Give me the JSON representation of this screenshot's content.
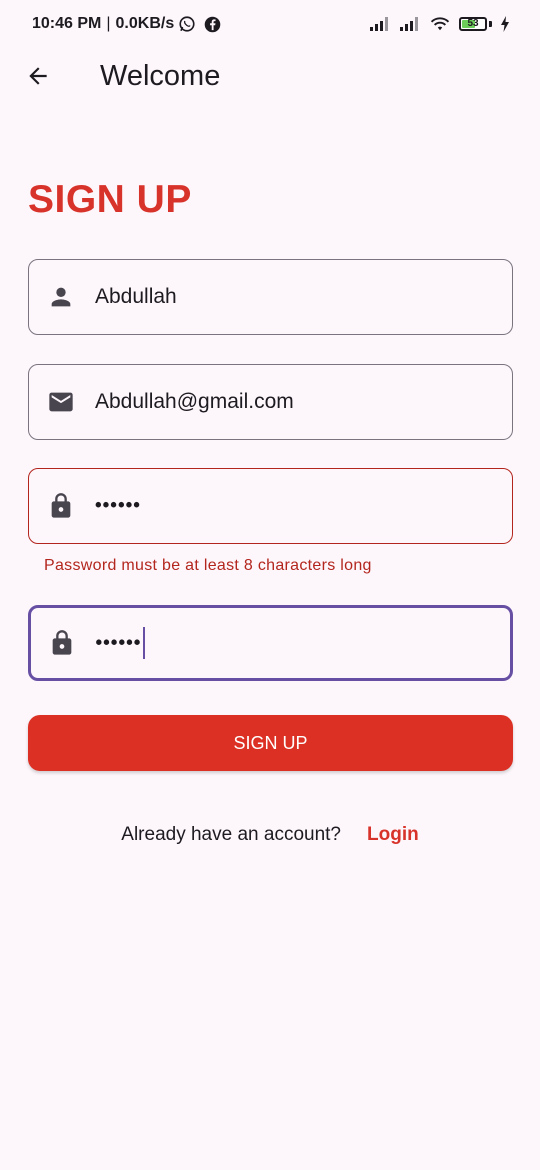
{
  "status_bar": {
    "time": "10:46 PM",
    "separator": "|",
    "speed": "0.0KB/s",
    "battery_level": "53",
    "battery_fraction": 0.53,
    "icons": [
      "whatsapp-icon",
      "facebook-icon",
      "signal-icon",
      "signal-icon",
      "wifi-icon",
      "battery-icon",
      "charging-icon"
    ]
  },
  "app_bar": {
    "title": "Welcome",
    "back_icon": "arrow-back-icon"
  },
  "form": {
    "heading": "SIGN UP",
    "name_value": "Abdullah",
    "email_value": "Abdullah@gmail.com",
    "password_value": "••••••",
    "confirm_password_value": "••••••",
    "password_error": "Password must be at least 8 characters long",
    "submit_label": "SIGN UP"
  },
  "footer": {
    "prompt": "Already have an account?",
    "login_label": "Login"
  },
  "colors": {
    "accent": "#d8332a",
    "button": "#dc3024",
    "error": "#b3261e",
    "focus": "#6750a4",
    "background": "#fdf7fc"
  }
}
